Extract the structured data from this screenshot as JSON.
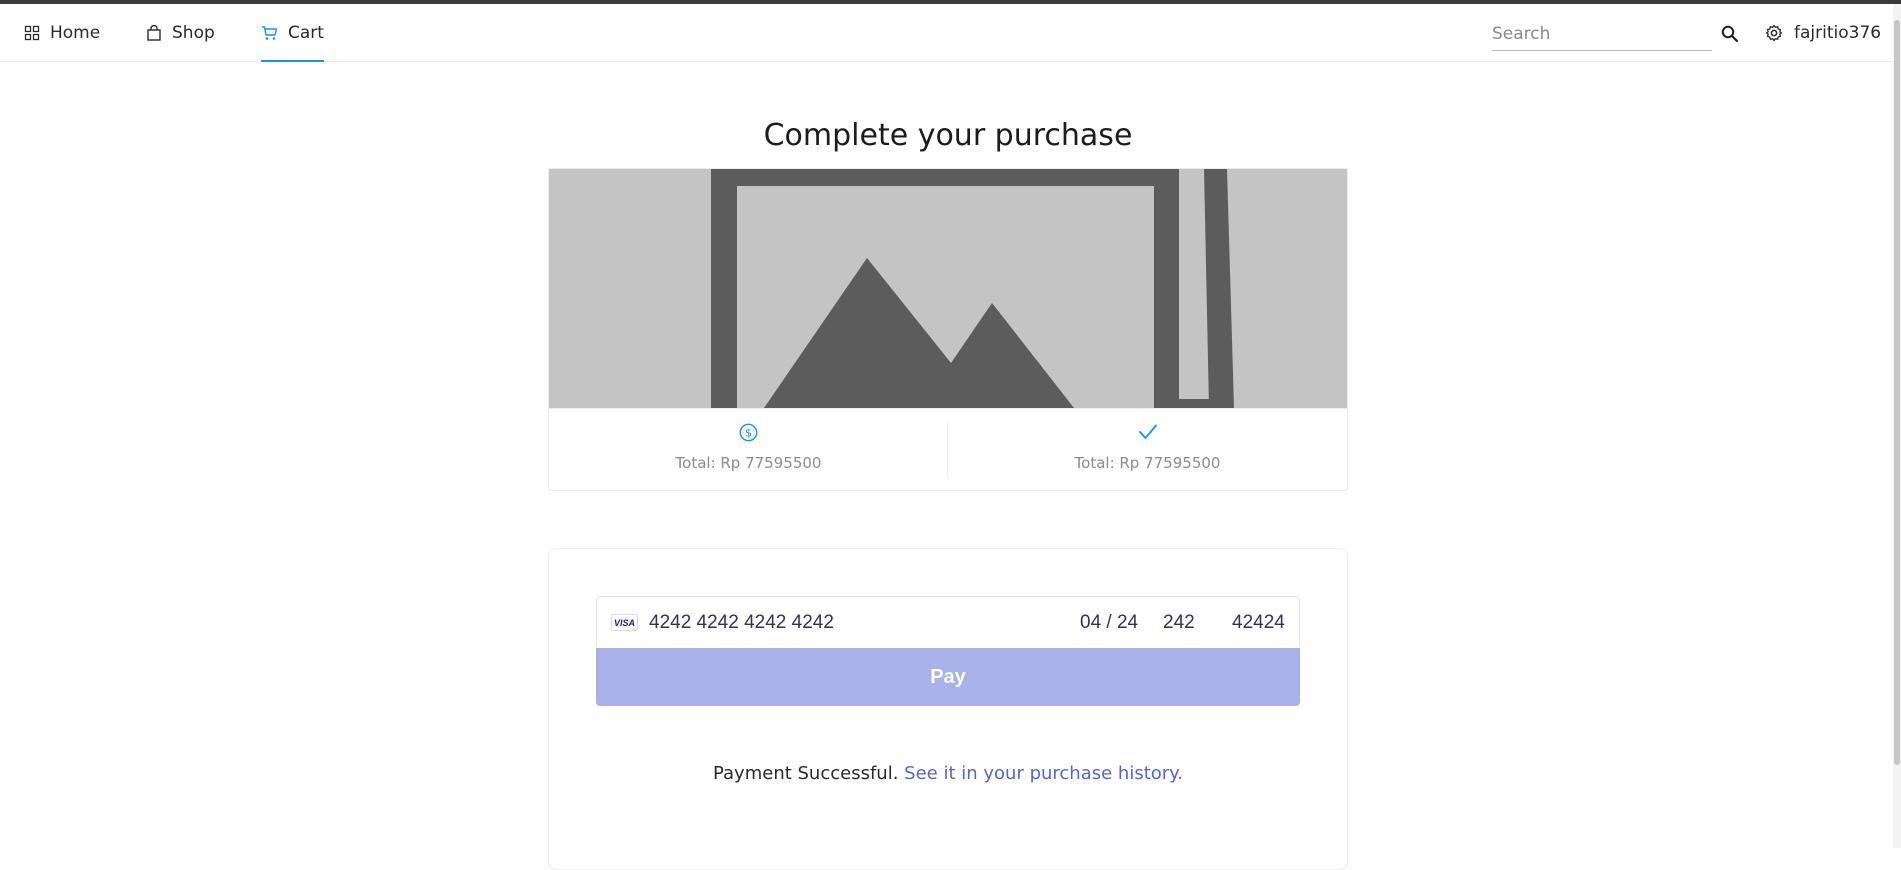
{
  "nav": {
    "items": [
      {
        "label": "Home",
        "icon": "appstore-icon"
      },
      {
        "label": "Shop",
        "icon": "shopping-bag-icon"
      },
      {
        "label": "Cart",
        "icon": "shopping-cart-icon",
        "active": true
      }
    ],
    "search_placeholder": "Search",
    "username": "fajritio376"
  },
  "page": {
    "title": "Complete your purchase"
  },
  "product_card": {
    "image": "placeholder-image-icon",
    "actions": [
      {
        "icon": "dollar-circle-icon",
        "text": "Total: Rp 77595500"
      },
      {
        "icon": "check-icon",
        "text": "Total: Rp 77595500"
      }
    ]
  },
  "payment": {
    "card_brand": "VISA",
    "card_number": "4242 4242 4242 4242",
    "expiry": "04 / 24",
    "cvc": "242",
    "zip": "42424",
    "pay_label": "Pay",
    "status_text": "Payment Successful.",
    "history_link": "See it in your purchase history."
  },
  "colors": {
    "accent": "#1890ff",
    "pay_button": "#a8b2e8",
    "link": "#5468c7",
    "muted_text": "#8c8c8c"
  }
}
